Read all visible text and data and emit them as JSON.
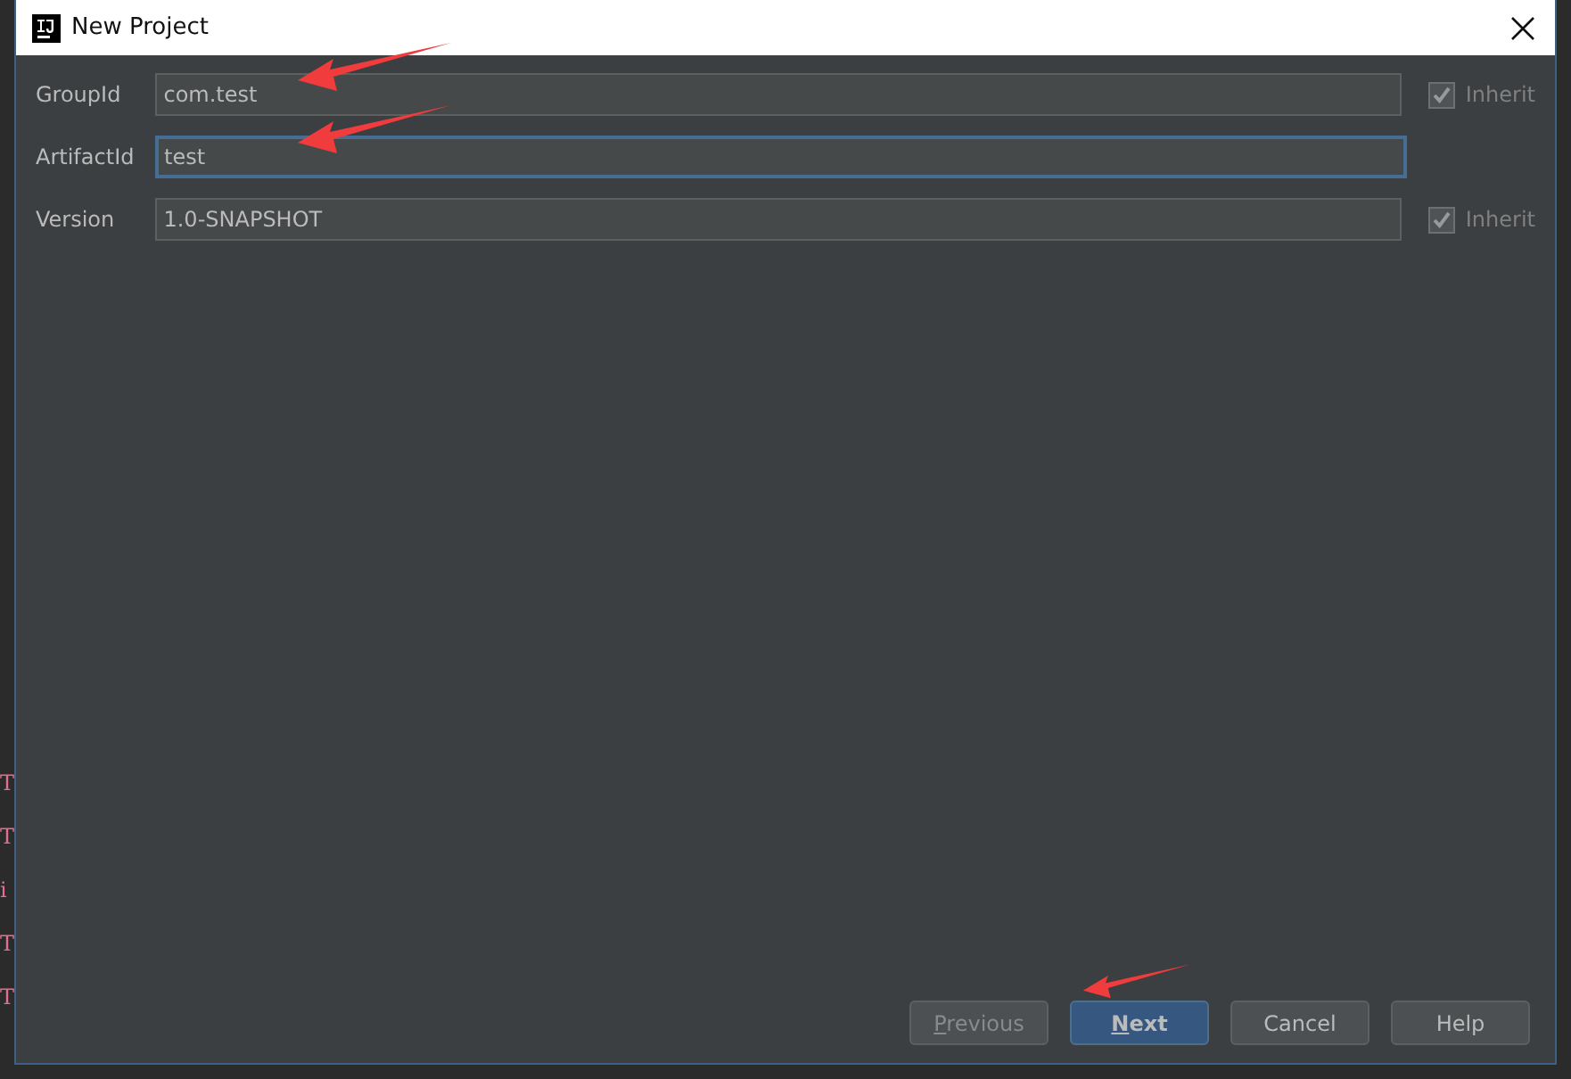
{
  "background_lines": [
    "T",
    "T",
    "i",
    "T",
    "T"
  ],
  "window": {
    "title": "New Project"
  },
  "fields": [
    {
      "label": "GroupId",
      "value": "com.test",
      "focused": false,
      "annotated": true,
      "inherit": {
        "label": "Inherit",
        "checked": true,
        "disabled": true
      }
    },
    {
      "label": "ArtifactId",
      "value": "test",
      "focused": true,
      "annotated": true
    },
    {
      "label": "Version",
      "value": "1.0-SNAPSHOT",
      "focused": false,
      "inherit": {
        "label": "Inherit",
        "checked": true,
        "disabled": true
      }
    }
  ],
  "buttons": [
    {
      "label": "Previous",
      "mnemonic": true,
      "default": false,
      "disabled": true
    },
    {
      "label": "Next",
      "mnemonic": true,
      "default": true,
      "disabled": false,
      "annotated": true
    },
    {
      "label": "Cancel",
      "default": false,
      "disabled": false
    },
    {
      "label": "Help",
      "default": false,
      "disabled": false
    }
  ]
}
